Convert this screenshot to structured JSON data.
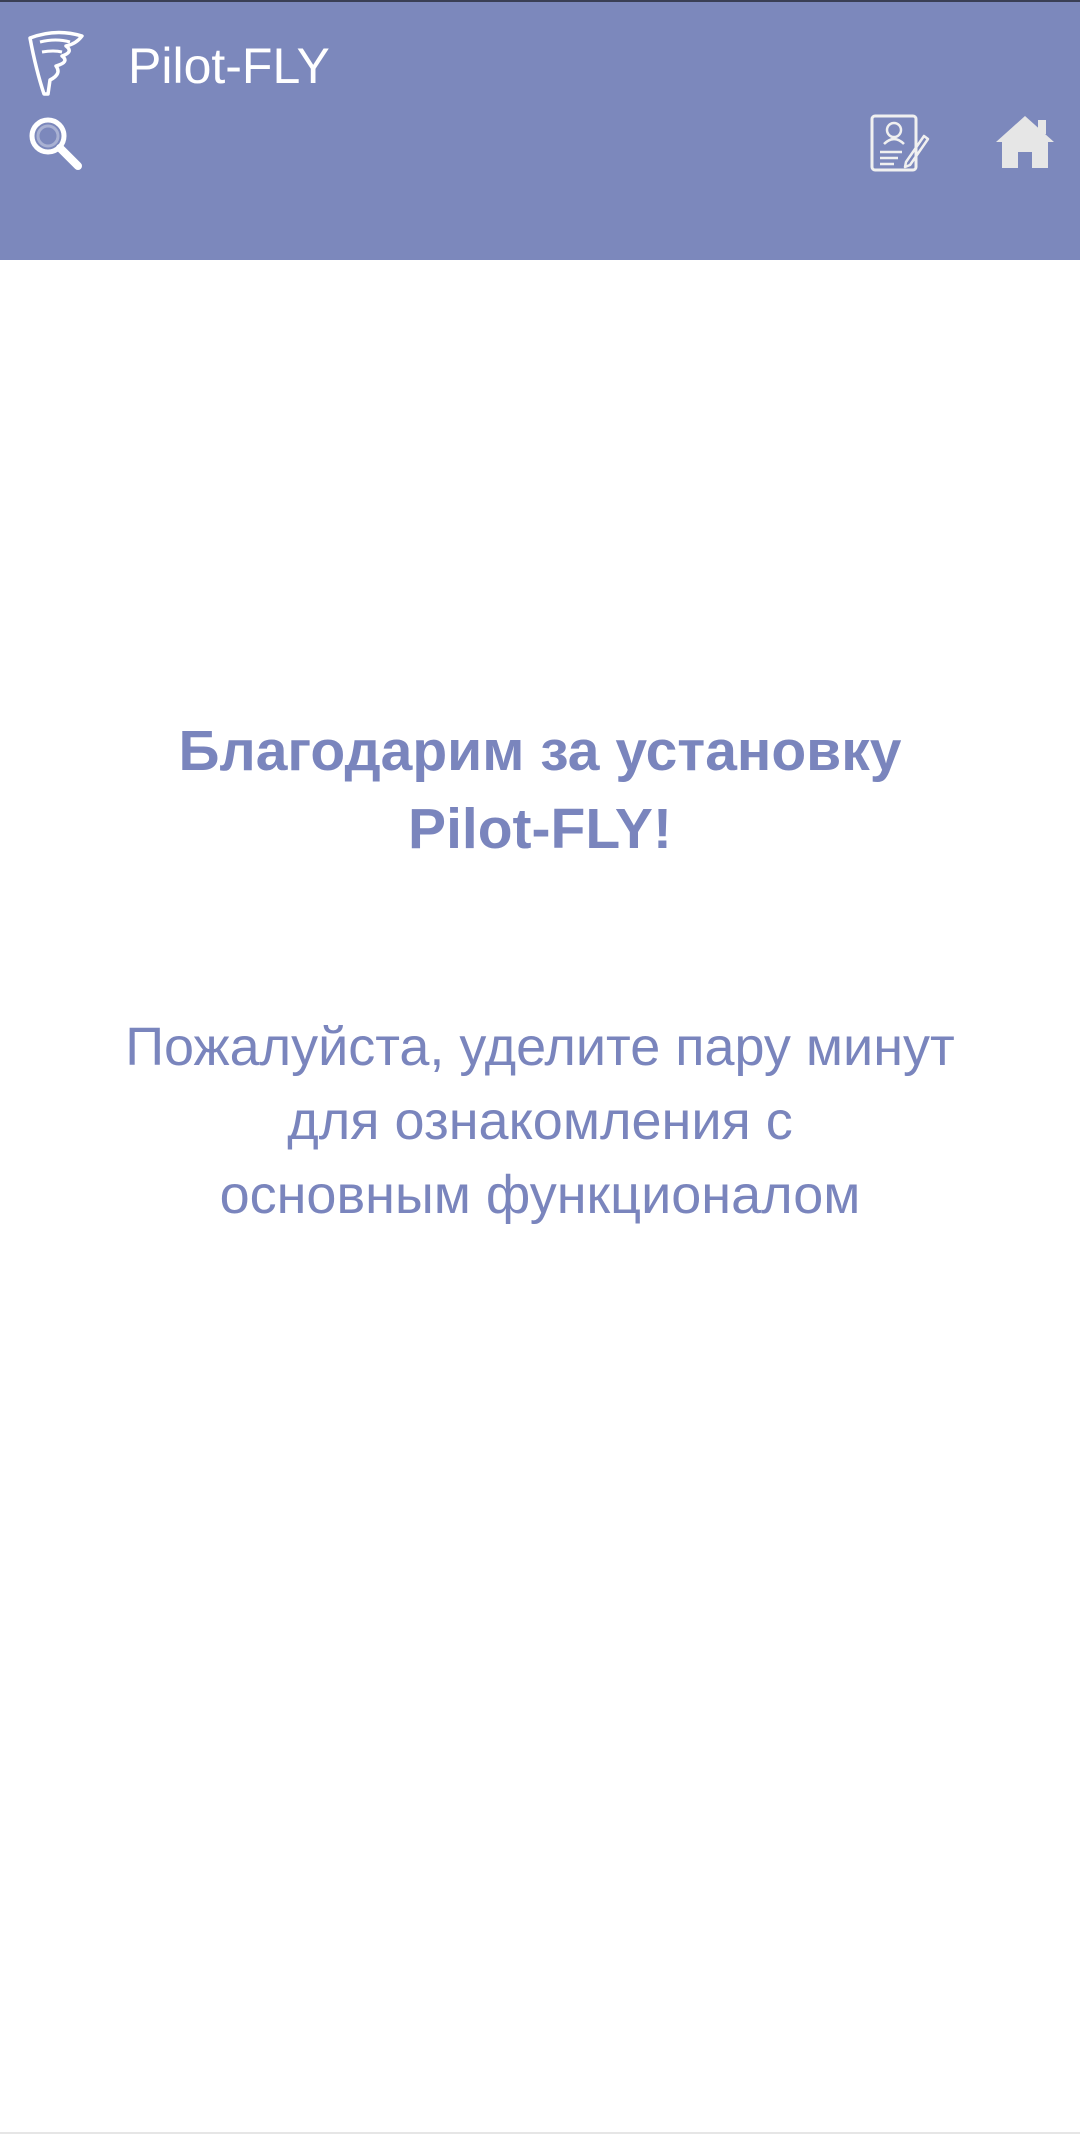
{
  "header": {
    "title": "Pilot-FLY",
    "logo_icon": "tornado-logo-icon",
    "search_icon": "search-icon",
    "profile_icon": "profile-document-edit-icon",
    "home_icon": "home-icon",
    "background_color": "#7c88bc"
  },
  "main": {
    "heading_lines": [
      "Благодарим за установку",
      "Pilot-FLY!"
    ],
    "subtext_lines": [
      "Пожалуйста, уделите пару минут",
      "для ознакомления с",
      "основным функционалом"
    ],
    "text_color": "#7a85bd"
  }
}
